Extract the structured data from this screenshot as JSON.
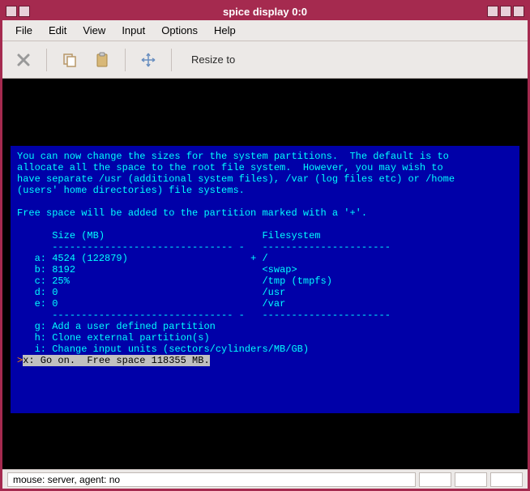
{
  "window": {
    "title": "spice display 0:0"
  },
  "menubar": {
    "items": [
      "File",
      "Edit",
      "View",
      "Input",
      "Options",
      "Help"
    ]
  },
  "toolbar": {
    "resize_label": "Resize to"
  },
  "console": {
    "intro1": "You can now change the sizes for the system partitions.  The default is to",
    "intro2": "allocate all the space to the root file system.  However, you may wish to",
    "intro3": "have separate /usr (additional system files), /var (log files etc) or /home",
    "intro4": "(users' home directories) file systems.",
    "freeline": "Free space will be added to the partition marked with a '+'.",
    "hdr_size": "Size (MB)",
    "hdr_fs": "Filesystem",
    "rule1": "------------------------------- -",
    "rule2": "----------------------",
    "rows": {
      "a": {
        "letter": "a:",
        "size": "4524 (122879)",
        "plus": "+",
        "fs": "/"
      },
      "b": {
        "letter": "b:",
        "size": "8192",
        "plus": " ",
        "fs": "<swap>"
      },
      "c": {
        "letter": "c:",
        "size": "25%",
        "plus": " ",
        "fs": "/tmp (tmpfs)"
      },
      "d": {
        "letter": "d:",
        "size": "0",
        "plus": " ",
        "fs": "/usr"
      },
      "e": {
        "letter": "e:",
        "size": "0",
        "plus": " ",
        "fs": "/var"
      }
    },
    "g": "g: Add a user defined partition",
    "h": "h: Clone external partition(s)",
    "i": "i: Change input units (sectors/cylinders/MB/GB)",
    "x_label": "x: Go on.  Free space 118355 MB.",
    "prompt": ">"
  },
  "statusbar": {
    "text": "mouse: server, agent:  no"
  }
}
